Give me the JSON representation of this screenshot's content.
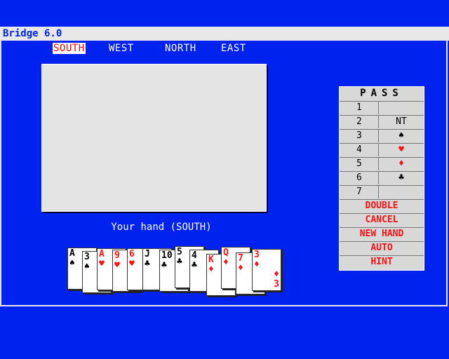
{
  "app": {
    "title": "Bridge 6.0"
  },
  "seats": [
    "SOUTH",
    "WEST",
    "NORTH",
    "EAST"
  ],
  "hand_label": "Your hand (SOUTH)",
  "hand": [
    {
      "rank": "A",
      "suit": "♠",
      "color": "black"
    },
    {
      "rank": "3",
      "suit": "♠",
      "color": "black"
    },
    {
      "rank": "A",
      "suit": "♥",
      "color": "red"
    },
    {
      "rank": "9",
      "suit": "♥",
      "color": "red"
    },
    {
      "rank": "6",
      "suit": "♥",
      "color": "red"
    },
    {
      "rank": "J",
      "suit": "♣",
      "color": "black"
    },
    {
      "rank": "10",
      "suit": "♣",
      "color": "black"
    },
    {
      "rank": "5",
      "suit": "♣",
      "color": "black"
    },
    {
      "rank": "4",
      "suit": "♣",
      "color": "black"
    },
    {
      "rank": "K",
      "suit": "♦",
      "color": "red"
    },
    {
      "rank": "Q",
      "suit": "♦",
      "color": "red"
    },
    {
      "rank": "7",
      "suit": "♦",
      "color": "red"
    },
    {
      "rank": "3",
      "suit": "♦",
      "color": "red"
    }
  ],
  "bidding": {
    "pass_label": "PASS",
    "levels": [
      {
        "level": "1",
        "strain": ""
      },
      {
        "level": "2",
        "strain": "NT"
      },
      {
        "level": "3",
        "strain": "♠"
      },
      {
        "level": "4",
        "strain": "♥"
      },
      {
        "level": "5",
        "strain": "♦"
      },
      {
        "level": "6",
        "strain": "♣"
      },
      {
        "level": "7",
        "strain": ""
      }
    ],
    "commands": [
      "DOUBLE",
      "CANCEL",
      "NEW HAND",
      "AUTO",
      "HINT"
    ]
  }
}
